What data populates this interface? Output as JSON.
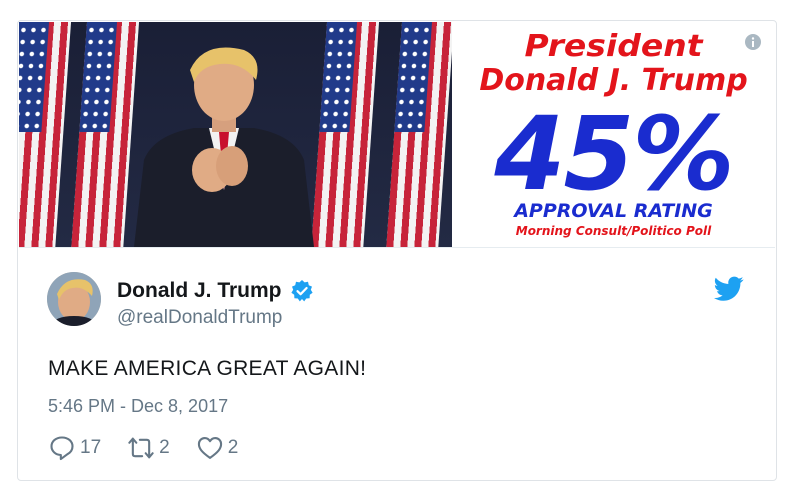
{
  "media": {
    "banner_line1": "President",
    "banner_line2": "Donald J. Trump",
    "banner_percent": "45%",
    "banner_rating": "APPROVAL RATING",
    "banner_source": "Morning Consult/Politico Poll",
    "info_icon": "info-icon"
  },
  "author": {
    "name": "Donald J. Trump",
    "handle": "@realDonaldTrump",
    "verified_icon": "verified-badge-icon"
  },
  "tweet": {
    "text": "MAKE AMERICA GREAT AGAIN!",
    "timestamp": "5:46 PM - Dec 8, 2017"
  },
  "actions": {
    "reply_count": "17",
    "retweet_count": "2",
    "like_count": "2"
  },
  "colors": {
    "twitter_blue": "#1da1f2",
    "text_primary": "#14171a",
    "text_secondary": "#657786",
    "banner_red": "#e3141b",
    "banner_blue": "#1a2ccf"
  }
}
